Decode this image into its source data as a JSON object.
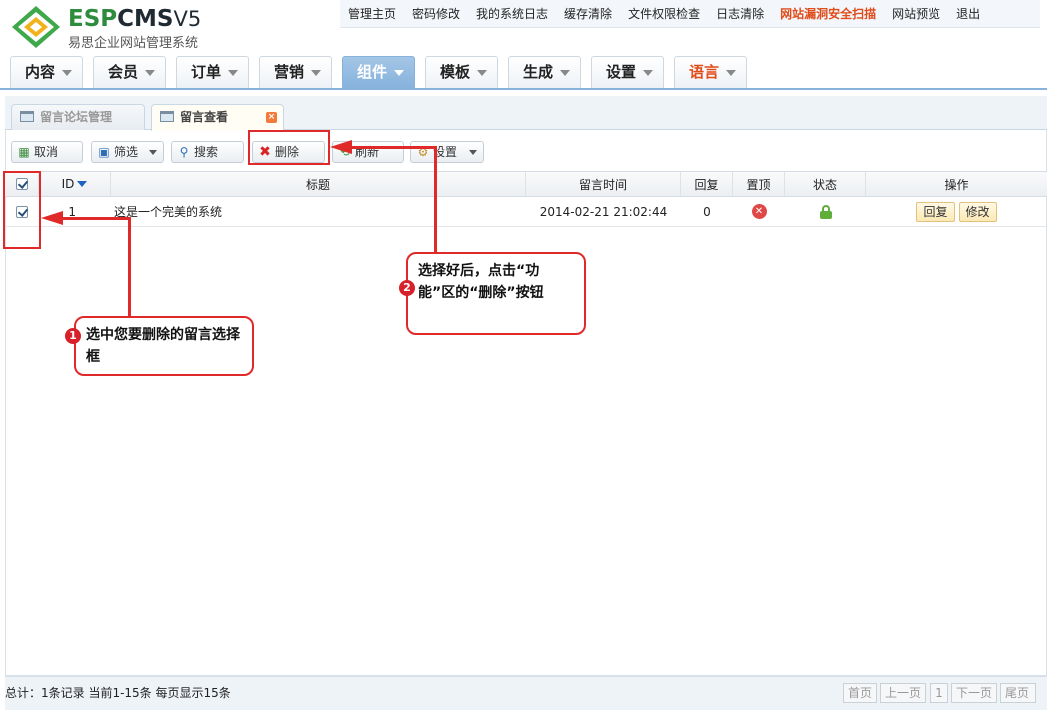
{
  "logo": {
    "brand_main": "ESP",
    "brand_mid": "CMS",
    "brand_ver": "V5",
    "subtitle": "易思企业网站管理系统"
  },
  "top_links": [
    "管理主页",
    "密码修改",
    "我的系统日志",
    "缓存清除",
    "文件权限检查",
    "日志清除",
    "网站漏洞安全扫描",
    "网站预览",
    "退出"
  ],
  "menu": [
    {
      "label": "内容"
    },
    {
      "label": "会员"
    },
    {
      "label": "订单"
    },
    {
      "label": "营销"
    },
    {
      "label": "组件",
      "active": true
    },
    {
      "label": "模板"
    },
    {
      "label": "生成"
    },
    {
      "label": "设置"
    },
    {
      "label": "语言"
    }
  ],
  "subtabs": {
    "tab1": "留言论坛管理",
    "tab2": "留言查看",
    "close": "×"
  },
  "toolbar": {
    "cancel": "取消",
    "filter": "筛选",
    "search": "搜索",
    "delete": "删除",
    "refresh": "刷新",
    "settings": "设置"
  },
  "table": {
    "headers": {
      "id": "ID",
      "title": "标题",
      "time": "留言时间",
      "replies": "回复",
      "top": "置顶",
      "status": "状态",
      "ops": "操作"
    },
    "rows": [
      {
        "id": "1",
        "title": "这是一个完美的系统",
        "time": "2014-02-21 21:02:44",
        "replies": "0",
        "reply_btn": "回复",
        "edit_btn": "修改"
      }
    ]
  },
  "footer": {
    "summary": "总计：1条记录 当前1-15条 每页显示15条",
    "pagination": {
      "first": "首页",
      "prev": "上一页",
      "page": "1",
      "next": "下一页",
      "last": "尾页"
    }
  },
  "annotations": {
    "callout1": {
      "num": "1",
      "text": "选中您要删除的留言选择框"
    },
    "callout2": {
      "num": "2",
      "text": "选择好后，点击“功能”区的“删除”按钮"
    }
  },
  "colors": {
    "accent": "#86b2dc",
    "alert": "#e04b1a",
    "annotation": "#e02a2a",
    "brand_green": "#2e8c3e"
  }
}
